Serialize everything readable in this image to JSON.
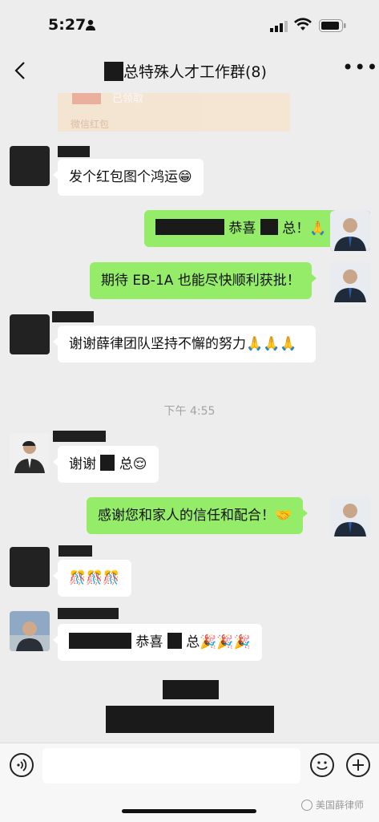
{
  "status_bar": {
    "time": "5:27"
  },
  "nav": {
    "title_suffix": "总特殊人才工作群(8)"
  },
  "red_packet_card": {
    "status": "已领取",
    "footer": "微信红包"
  },
  "messages": {
    "m1": {
      "text": "发个红包图个鸿运😁"
    },
    "m2": {
      "text": "恭喜",
      "text_tail": "总！🙏"
    },
    "m3": {
      "text": "期待 EB-1A 也能尽快顺利获批！"
    },
    "m4": {
      "text": "谢谢薛律团队坚持不懈的努力🙏🙏🙏"
    },
    "timestamp": "下午 4:55",
    "m5": {
      "text": "谢谢",
      "text_tail": "总😌"
    },
    "m6": {
      "text": "感谢您和家人的信任和配合！🤝"
    },
    "m7": {
      "text": "🎊🎊🎊"
    },
    "m8": {
      "text": "恭喜",
      "text_tail": "总🎉🎉🎉"
    }
  },
  "watermark": {
    "text": "美国薛律师"
  },
  "colors": {
    "green_bubble": "#95ec69",
    "background": "#ededed",
    "redact": "#1a1a1a"
  }
}
